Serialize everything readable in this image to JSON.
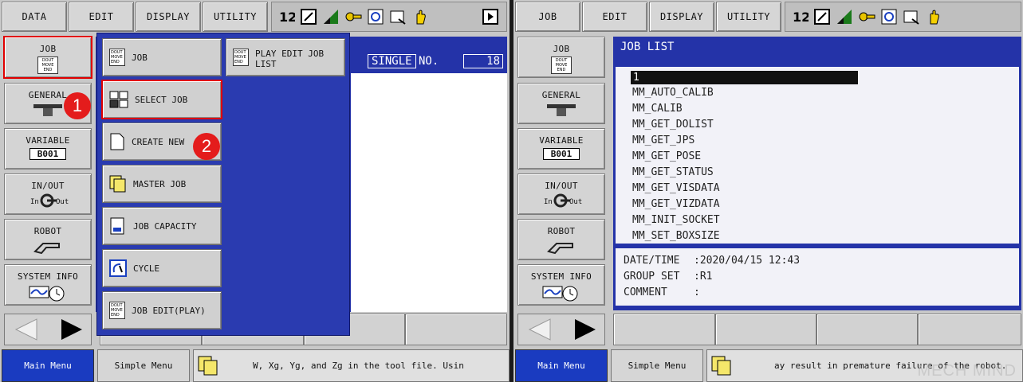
{
  "menubar": {
    "data": "DATA",
    "edit": "EDIT",
    "display": "DISPLAY",
    "utility": "UTILITY"
  },
  "side_menu": {
    "job": "JOB",
    "general": "GENERAL",
    "variable": "VARIABLE",
    "variable_box": "B001",
    "inout": "IN/OUT",
    "in": "In",
    "out": "Out",
    "robot": "ROBOT",
    "system_info": "SYSTEM INFO"
  },
  "doc_icon_lines": [
    "DOUT",
    "MOVE",
    "END"
  ],
  "submenu": {
    "job": "JOB",
    "play_edit_job_list": "PLAY EDIT JOB LIST",
    "select_job": "SELECT JOB",
    "create_new": "CREATE NEW",
    "master_job": "MASTER JOB",
    "job_capacity": "JOB CAPACITY",
    "cycle": "CYCLE",
    "job_edit_play": "JOB EDIT(PLAY)"
  },
  "badges": {
    "first": "1",
    "second": "2"
  },
  "left_content": {
    "mode": "SINGLE",
    "no_label": "NO.",
    "no_value": "18"
  },
  "job_list": {
    "title": "JOB LIST",
    "selected": "1",
    "items": [
      "MM_AUTO_CALIB",
      "MM_CALIB",
      "MM_GET_DOLIST",
      "MM_GET_JPS",
      "MM_GET_POSE",
      "MM_GET_STATUS",
      "MM_GET_VISDATA",
      "MM_GET_VIZDATA",
      "MM_INIT_SOCKET",
      "MM_SET_BOXSIZE"
    ],
    "date_label": "DATE/TIME",
    "date_value": ":2020/04/15 12:43",
    "group_label": "GROUP SET",
    "group_value": ":R1",
    "comment_label": "COMMENT",
    "comment_value": ":"
  },
  "bottom": {
    "main_menu": "Main Menu",
    "simple_menu": "Simple Menu",
    "msg_left": "W, Xg, Yg, and Zg in the tool file.   Usin",
    "msg_right": "ay result in premature failure of the robot."
  },
  "watermark": "MECH MIND",
  "colors": {
    "accent_blue": "#2433a8",
    "highlight_red": "#e00000",
    "badge_red": "#e41c1c"
  }
}
